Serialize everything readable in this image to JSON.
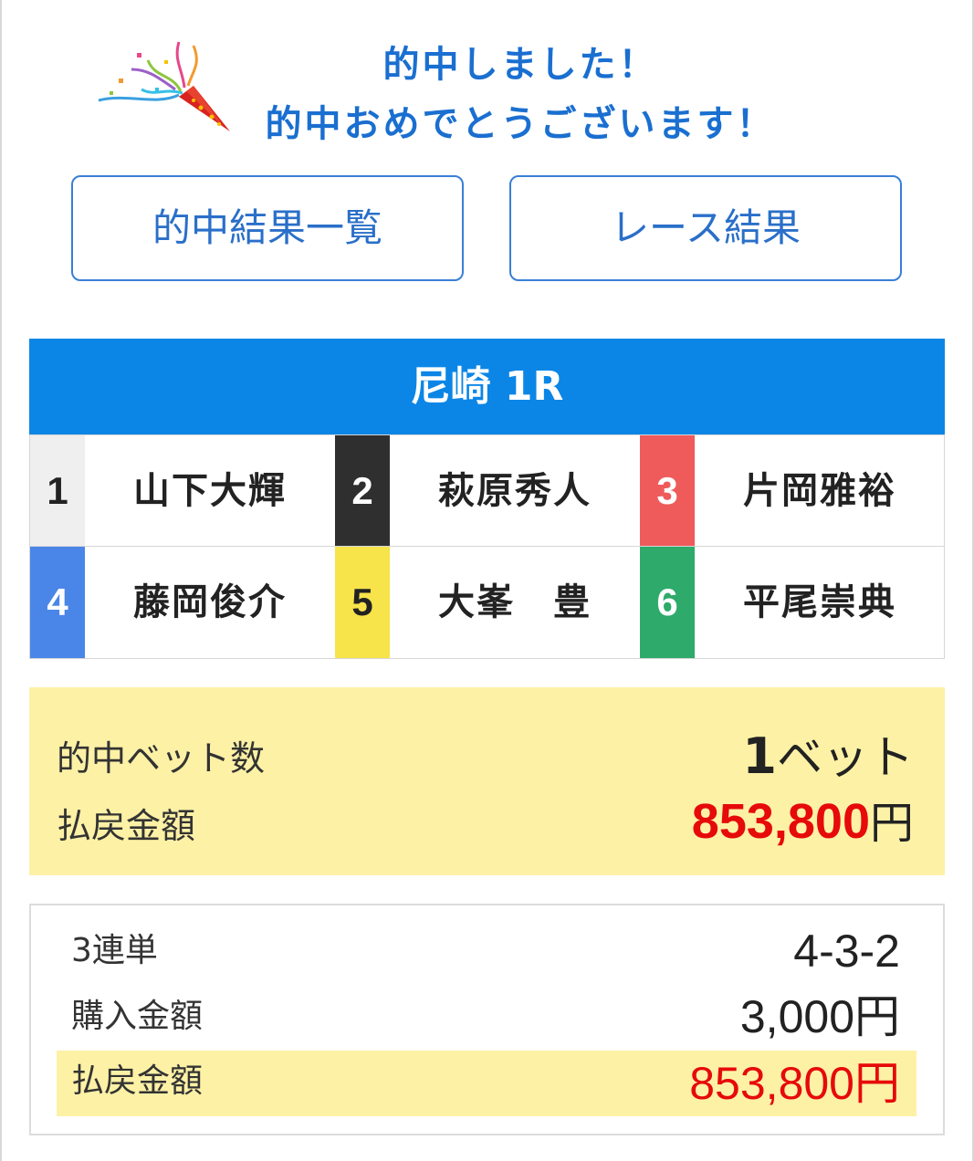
{
  "header": {
    "line1": "的中しました！",
    "line2": "的中おめでとうございます！",
    "icon": "party-popper-icon"
  },
  "nav": {
    "results_list": "的中結果一覧",
    "race_results": "レース結果"
  },
  "race": {
    "title": "尼崎 1R",
    "racers": [
      {
        "number": "1",
        "name": "山下大輝",
        "bg": "#efefef",
        "fg": "#222222"
      },
      {
        "number": "2",
        "name": "萩原秀人",
        "bg": "#2f2f2f",
        "fg": "#ffffff"
      },
      {
        "number": "3",
        "name": "片岡雅裕",
        "bg": "#ef5b5b",
        "fg": "#ffffff"
      },
      {
        "number": "4",
        "name": "藤岡俊介",
        "bg": "#4a86e8",
        "fg": "#ffffff"
      },
      {
        "number": "5",
        "name": "大峯　豊",
        "bg": "#f7e34a",
        "fg": "#222222"
      },
      {
        "number": "6",
        "name": "平尾崇典",
        "bg": "#2eaa6a",
        "fg": "#ffffff"
      }
    ]
  },
  "summary": {
    "bets_label": "的中ベット数",
    "bets_count": "1",
    "bets_unit": "ベット",
    "payout_label": "払戻金額",
    "payout_amount": "853,800",
    "payout_unit": "円"
  },
  "detail": {
    "type_label": "3連単",
    "combination": "4-3-2",
    "purchase_label": "購入金額",
    "purchase_amount": "3,000円",
    "payout_label": "払戻金額",
    "payout_amount": "853,800円"
  },
  "colors": {
    "accent": "#0b86e6",
    "payout": "#e60a0a",
    "highlight": "#fdf1a6"
  }
}
